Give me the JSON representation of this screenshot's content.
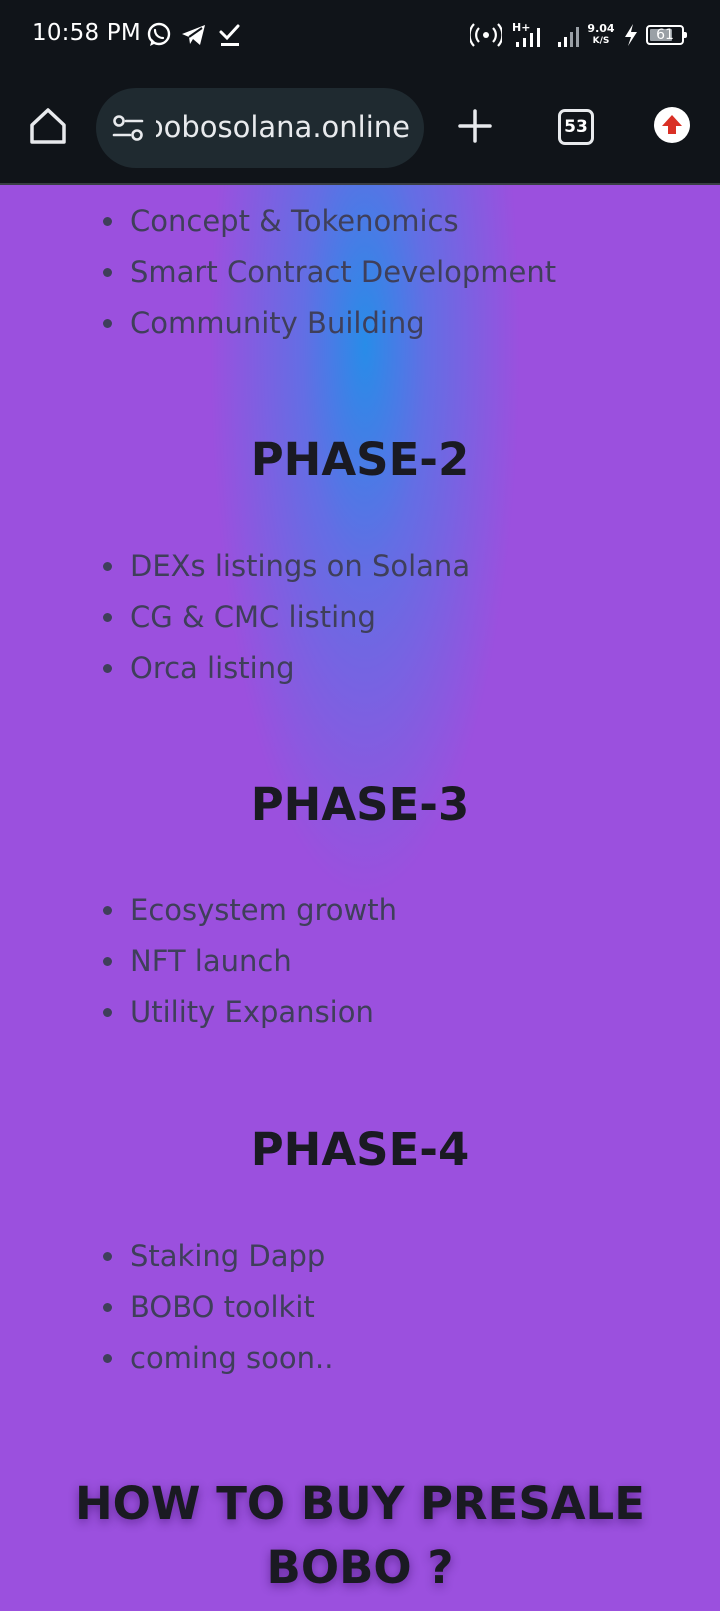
{
  "status_bar": {
    "time": "10:58 PM",
    "speed_value": "9.04",
    "speed_unit": "K/S",
    "battery": "61",
    "network_label": "H+"
  },
  "browser": {
    "url": "bobosolana.online",
    "tab_count": "53"
  },
  "roadmap": {
    "phase1_items": [
      "Concept & Tokenomics",
      "Smart Contract Development",
      "Community Building"
    ],
    "phase2": {
      "title": "PHASE-2",
      "items": [
        "DEXs listings on Solana",
        "CG & CMC listing",
        "Orca listing"
      ]
    },
    "phase3": {
      "title": "PHASE-3",
      "items": [
        "Ecosystem growth",
        "NFT launch",
        "Utility Expansion"
      ]
    },
    "phase4": {
      "title": "PHASE-4",
      "items": [
        "Staking Dapp",
        "BOBO toolkit",
        "coming soon.."
      ]
    }
  },
  "how_to_buy": {
    "title_line1": "HOW TO BUY PRESALE",
    "title_line2": "BOBO ?"
  },
  "colors": {
    "page_bg": "#9b50de",
    "glow": "#288ce8",
    "chrome_bg": "#101419",
    "url_bg": "#1f2a30",
    "update_red": "#d93025"
  }
}
